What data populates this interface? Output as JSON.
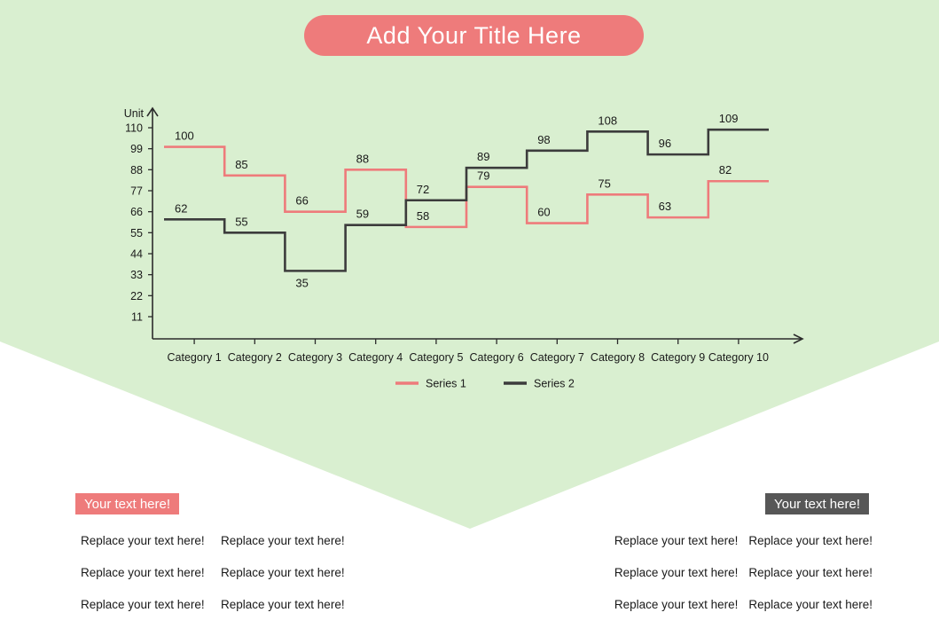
{
  "title": {
    "text": "Add Your Title Here"
  },
  "colors": {
    "background_green": "#D9EFD0",
    "page_white": "#FFFFFF",
    "series1": "#EE7B7B",
    "series2": "#3C3C3C",
    "axis": "#2B2B2B",
    "badge_pink": "#EE7B7B",
    "badge_dark": "#575757",
    "text_dark": "#1A1A1A"
  },
  "chart_data": {
    "type": "line",
    "variant": "step",
    "title": "",
    "xlabel": "",
    "ylabel": "Unit",
    "unit_label": "Unit",
    "grid": false,
    "legend_position": "bottom",
    "ylim": [
      0,
      110
    ],
    "yticks": [
      11,
      22,
      33,
      44,
      55,
      66,
      77,
      88,
      99,
      110
    ],
    "categories": [
      "Category 1",
      "Category 2",
      "Category 3",
      "Category 4",
      "Category 5",
      "Category 6",
      "Category 7",
      "Category 8",
      "Category 9",
      "Category 10"
    ],
    "series": [
      {
        "name": "Series 1",
        "color": "#EE7B7B",
        "values": [
          100,
          85,
          66,
          88,
          58,
          79,
          60,
          75,
          63,
          82
        ]
      },
      {
        "name": "Series 2",
        "color": "#3C3C3C",
        "values": [
          62,
          55,
          35,
          59,
          72,
          89,
          98,
          108,
          96,
          109
        ]
      }
    ]
  },
  "bottom": {
    "left": {
      "badge": "Your text here!",
      "rows": [
        [
          "Replace your text here!",
          "Replace your text here!"
        ],
        [
          "Replace your text here!",
          "Replace your text here!"
        ],
        [
          "Replace your text here!",
          "Replace your text here!"
        ]
      ]
    },
    "right": {
      "badge": "Your text here!",
      "rows": [
        [
          "Replace your text here!",
          "Replace your text here!"
        ],
        [
          "Replace your text here!",
          "Replace your text here!"
        ],
        [
          "Replace your text here!",
          "Replace your text here!"
        ]
      ]
    }
  }
}
